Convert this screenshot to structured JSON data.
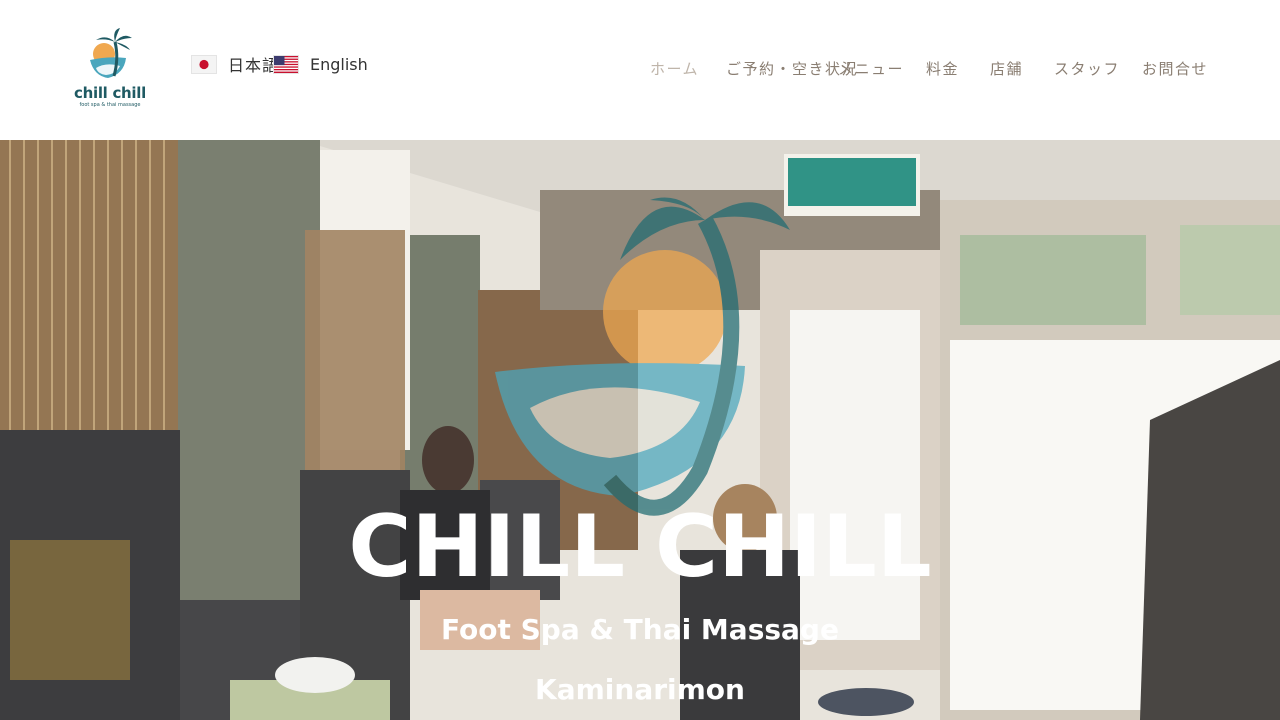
{
  "header": {
    "logo": {
      "wordmark": "chill chill",
      "tagline": "foot spa & thai massage",
      "icon": "palm-tree-logo-icon"
    },
    "languages": [
      {
        "label": "日本語",
        "icon": "japan-flag-icon"
      },
      {
        "label": "English",
        "icon": "usa-flag-icon"
      }
    ],
    "nav": [
      "ホーム",
      "ご予約・空き状況",
      "メニュー",
      "料金",
      "店舗",
      "スタッフ",
      "お問合せ"
    ]
  },
  "hero": {
    "title": "CHILL CHILL",
    "subtitle": "Foot Spa & Thai Massage",
    "location": "Kaminarimon",
    "watermark_icon": "palm-tree-logo-icon"
  },
  "colors": {
    "brand_teal": "#1f5a63",
    "logo_orange": "#f0a850",
    "logo_sea": "#4aa6bd",
    "nav_text": "#8a7e72",
    "nav_active": "#bfb5aa"
  }
}
